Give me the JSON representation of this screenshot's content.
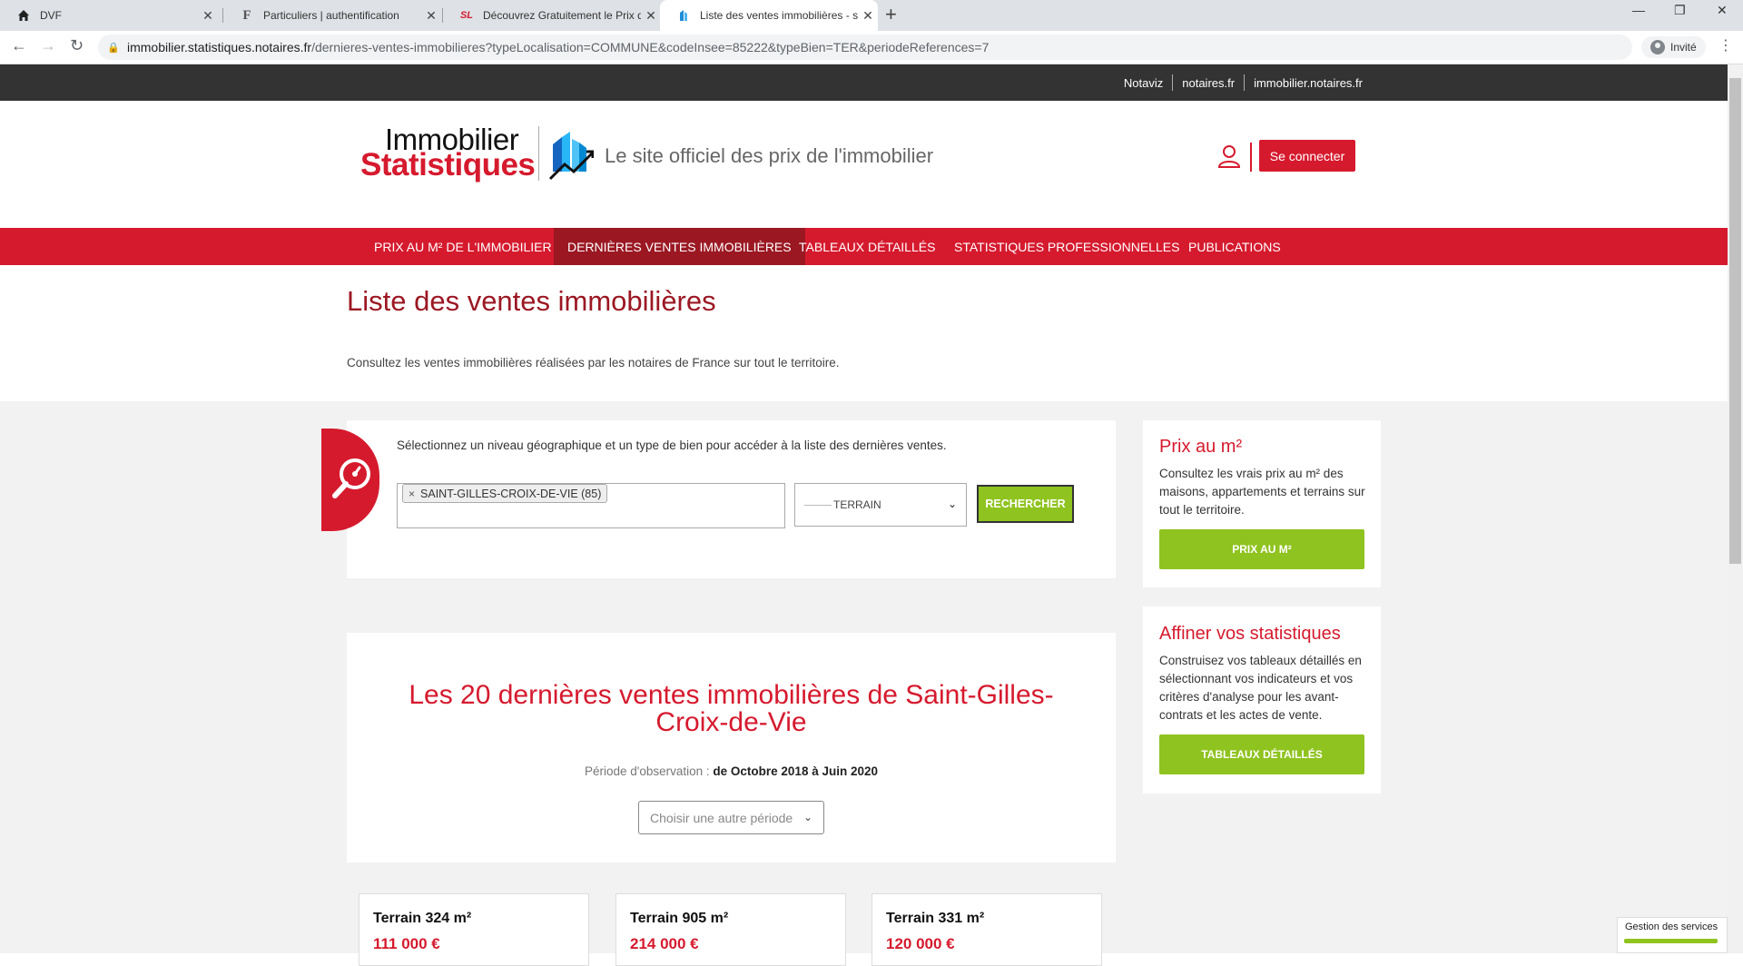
{
  "browser": {
    "tabs": [
      {
        "title": "DVF",
        "icon": "home-icon"
      },
      {
        "title": "Particuliers | authentification",
        "icon": "f-favicon"
      },
      {
        "title": "Découvrez Gratuitement le Prix d",
        "icon": "sl-favicon"
      },
      {
        "title": "Liste des ventes immobilières - st",
        "icon": "notaires-favicon",
        "active": true
      }
    ],
    "url_host": "immobilier.statistiques.notaires.fr",
    "url_path": "/dernieres-ventes-immobilieres?typeLocalisation=COMMUNE&codeInsee=85222&typeBien=TER&periodeReferences=7",
    "profile_label": "Invité"
  },
  "site": {
    "toplinks": [
      "Notaviz",
      "notaires.fr",
      "immobilier.notaires.fr"
    ],
    "logo_line1": "Immobilier",
    "logo_line2": "Statistiques",
    "tagline": "Le site officiel des prix de l'immobilier",
    "login_label": "Se connecter",
    "nav": [
      "PRIX AU M² DE L'IMMOBILIER",
      "DERNIÈRES VENTES IMMOBILIÈRES",
      "TABLEAUX DÉTAILLÉS",
      "STATISTIQUES PROFESSIONNELLES",
      "PUBLICATIONS"
    ],
    "nav_active": 1
  },
  "page": {
    "title": "Liste des ventes immobilières",
    "intro": "Consultez les ventes immobilières réalisées par les notaires de France sur tout le territoire."
  },
  "search": {
    "instruction": "Sélectionnez un niveau géographique et un type de bien pour accéder à la liste des dernières ventes.",
    "location_chip": "SAINT-GILLES-CROIX-DE-VIE (85)",
    "chip_remove": "×",
    "type_value": "TERRAIN",
    "button_label": "RECHERCHER"
  },
  "sidebar": {
    "prix": {
      "title": "Prix au m²",
      "text": "Consultez les vrais prix au m² des maisons, appartements et terrains sur tout le territoire.",
      "button": "PRIX AU M²"
    },
    "affiner": {
      "title": "Affiner vos statistiques",
      "text": "Construisez vos tableaux détaillés en sélectionnant vos indicateurs et vos critères d'analyse pour les avant-contrats et les actes de vente.",
      "button": "TABLEAUX DÉTAILLÉS"
    }
  },
  "results": {
    "title": "Les 20 dernières ventes immobilières de Saint-Gilles-Croix-de-Vie",
    "period_label": "Période d'observation : ",
    "period_value": "de Octobre 2018 à Juin 2020",
    "period_select": "Choisir une autre période",
    "sales": [
      {
        "title": "Terrain 324 m²",
        "price": "111 000 €"
      },
      {
        "title": "Terrain 905 m²",
        "price": "214 000 €"
      },
      {
        "title": "Terrain 331 m²",
        "price": "120 000 €"
      }
    ]
  },
  "footer_widget": {
    "label": "Gestion des services"
  }
}
